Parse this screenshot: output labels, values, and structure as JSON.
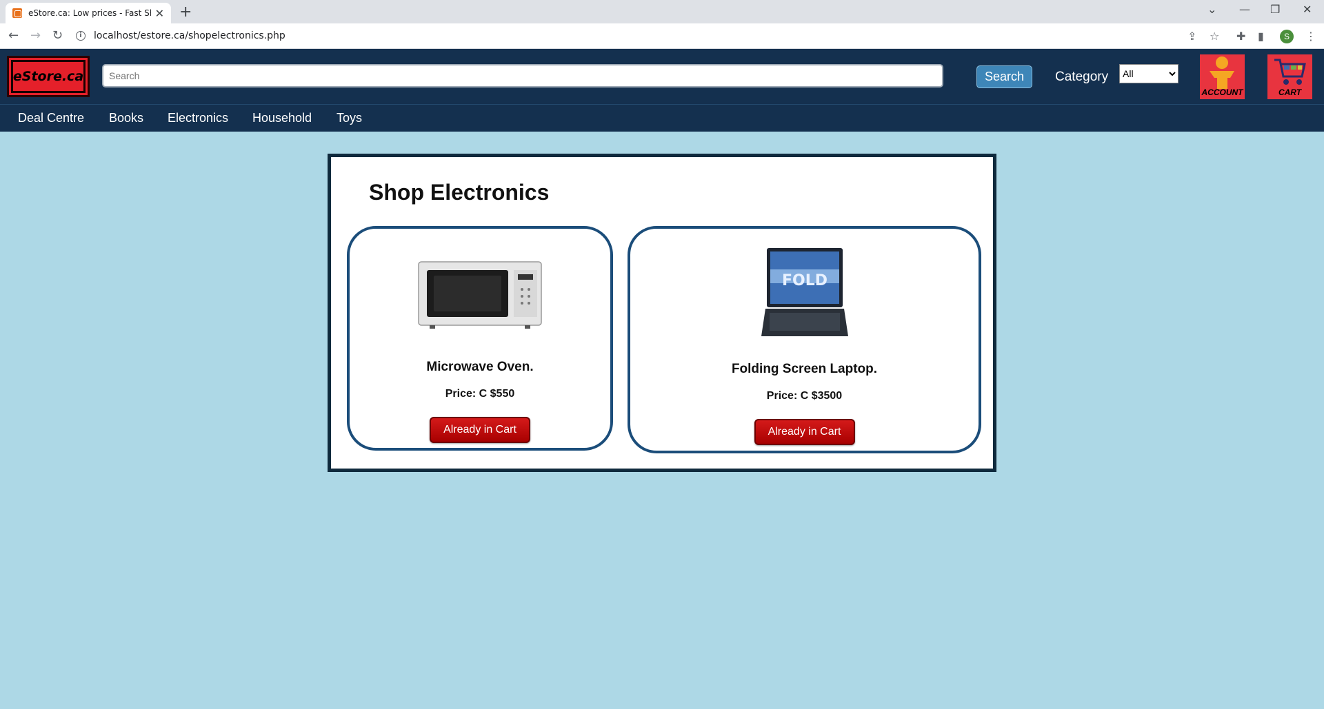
{
  "browser": {
    "tab_title": "eStore.ca: Low prices - Fast Shipping",
    "tab_close": "✕",
    "new_tab": "+",
    "url": "localhost/estore.ca/shopelectronics.php",
    "profile_initial": "S"
  },
  "header": {
    "logo_text": "eStore.ca",
    "search_placeholder": "Search",
    "search_button": "Search",
    "category_label": "Category",
    "category_selected": "All",
    "account_label": "ACCOUNT",
    "cart_label": "CART"
  },
  "nav": {
    "items": [
      "Deal Centre",
      "Books",
      "Electronics",
      "Household",
      "Toys"
    ]
  },
  "main": {
    "title": "Shop Electronics",
    "products": [
      {
        "name": "Microwave Oven.",
        "price": "Price: C $550",
        "button": "Already in Cart"
      },
      {
        "name": "Folding Screen Laptop.",
        "price": "Price: C $3500",
        "button": "Already in Cart"
      }
    ]
  },
  "colors": {
    "page_bg": "#add8e6",
    "header_bg": "#14304f",
    "accent_red": "#e5202a",
    "card_border": "#1b4d7a",
    "button_red": "#c00000"
  }
}
